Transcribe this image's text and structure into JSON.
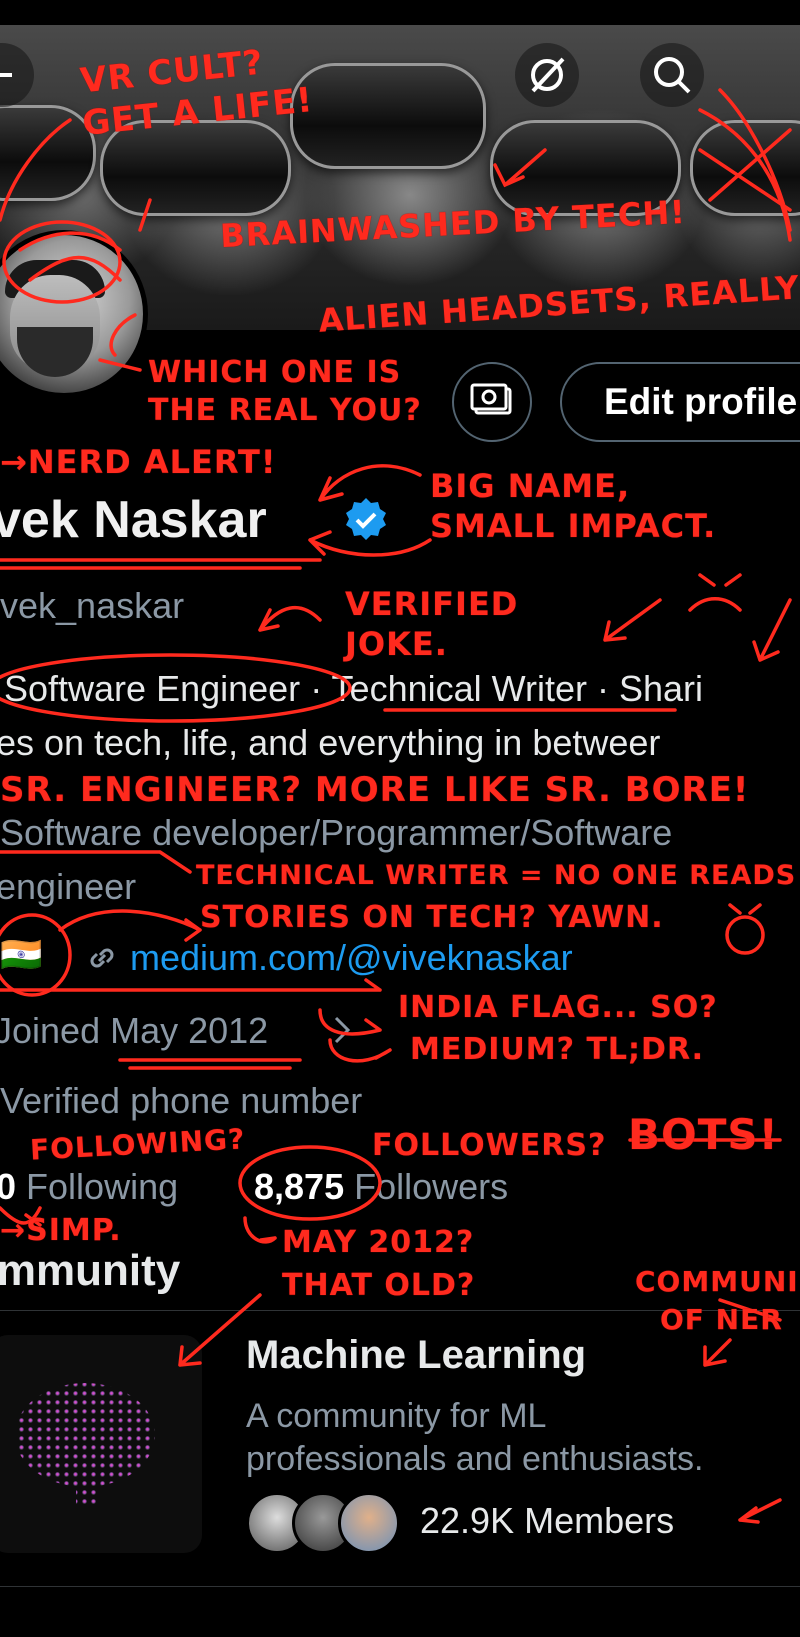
{
  "banner": {
    "icons": {
      "grok": "grok-icon",
      "search": "search-icon",
      "back": "back-arrow-icon"
    }
  },
  "actions": {
    "edit_profile": "Edit profile",
    "icon": "money-icon"
  },
  "profile": {
    "name": "vek Naskar",
    "handle": "ivek_naskar",
    "bio_line1_a": "Software Engineer",
    "bio_line1_b": "· Technical Writer · Shari",
    "bio_line2": "ries on tech, life, and everything in betweer",
    "category_line1": "Software developer/Programmer/Software",
    "category_line2": "engineer",
    "flag": "🇮🇳",
    "link": "medium.com/@viveknaskar",
    "joined": "Joined May 2012",
    "verified_phone": "Verified phone number",
    "following_count": "0",
    "following_label": "Following",
    "followers_count": "8,875",
    "followers_label": "Followers"
  },
  "community_section": {
    "title": "ommunity",
    "card": {
      "title": "Machine Learning",
      "desc_line1": "A community for ML",
      "desc_line2": "professionals and enthusiasts.",
      "members": "22.9K Members"
    }
  },
  "annotations": {
    "a1": "VR CULT?",
    "a2": "GET A LIFE!",
    "a3": "BRAINWASHED BY TECH!",
    "a4": "ALIEN HEADSETS, REALLY",
    "a5": "WHICH ONE IS",
    "a6": "THE REAL YOU?",
    "a7": "→NERD ALERT!",
    "a8": "BIG NAME,",
    "a9": "SMALL IMPACT.",
    "a10": "VERIFIED",
    "a11": "JOKE.",
    "a12": "SR. ENGINEER? MORE LIKE SR. BORE!",
    "a13": "TECHNICAL WRITER = NO ONE READS",
    "a14": "STORIES ON TECH? YAWN.",
    "a15": "INDIA FLAG... SO?",
    "a16": "MEDIUM? TL;DR.",
    "a17": "FOLLOWING?",
    "a18": "FOLLOWERS?",
    "a19": "BOTS!",
    "a20": "→SIMP.",
    "a21": "MAY 2012?",
    "a22": "THAT OLD?",
    "a23": "COMMUNI",
    "a24": "OF NER"
  },
  "colors": {
    "accent": "#1d9bf0",
    "annotation": "#ff2a1e",
    "muted": "#8b98a5"
  }
}
